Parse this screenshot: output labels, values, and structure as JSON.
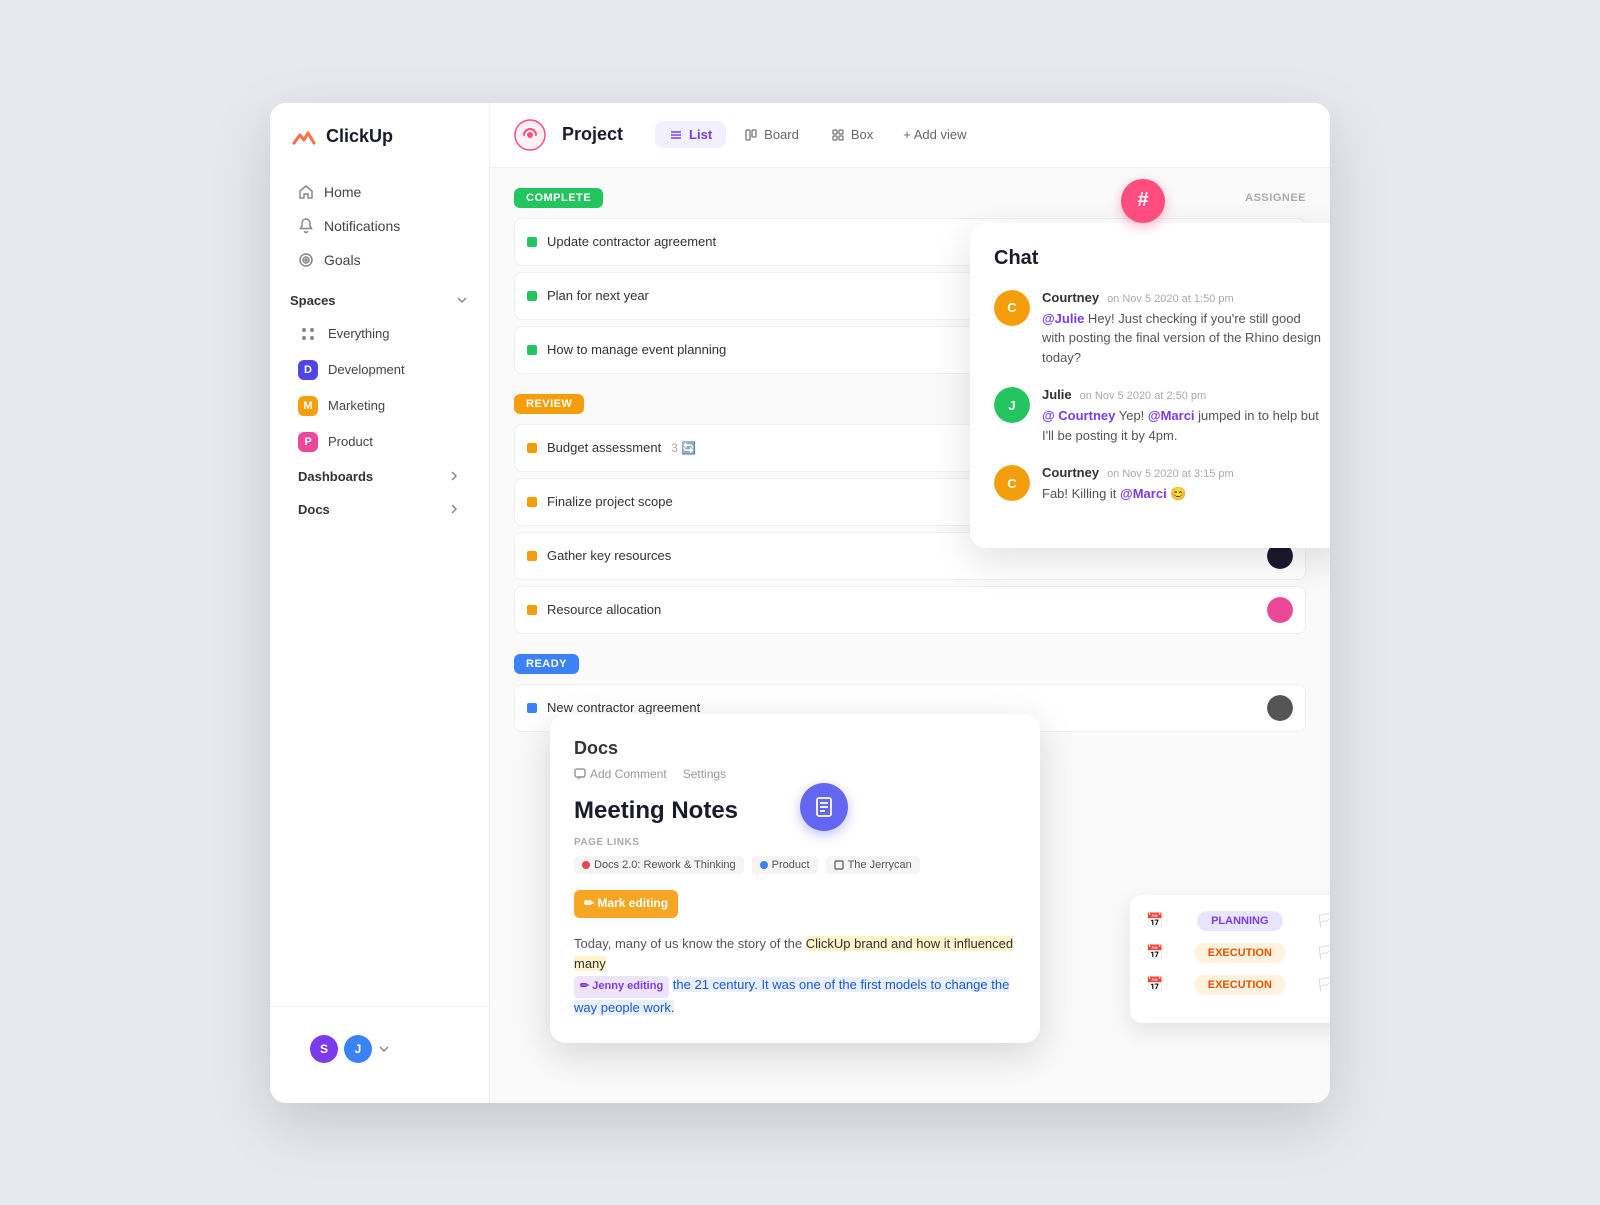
{
  "logo": {
    "text": "ClickUp"
  },
  "sidebar": {
    "nav_items": [
      {
        "id": "home",
        "label": "Home",
        "icon": "home-icon"
      },
      {
        "id": "notifications",
        "label": "Notifications",
        "icon": "bell-icon"
      },
      {
        "id": "goals",
        "label": "Goals",
        "icon": "goals-icon"
      }
    ],
    "spaces_label": "Spaces",
    "spaces": [
      {
        "id": "everything",
        "label": "Everything",
        "type": "everything"
      },
      {
        "id": "development",
        "label": "Development",
        "type": "badge",
        "color": "#4f46e5",
        "letter": "D"
      },
      {
        "id": "marketing",
        "label": "Marketing",
        "type": "badge",
        "color": "#f59e0b",
        "letter": "M"
      },
      {
        "id": "product",
        "label": "Product",
        "type": "badge",
        "color": "#ec4899",
        "letter": "P"
      }
    ],
    "expandable": [
      {
        "id": "dashboards",
        "label": "Dashboards"
      },
      {
        "id": "docs",
        "label": "Docs"
      }
    ],
    "users": [
      {
        "initials": "S",
        "color": "#7c3aed"
      },
      {
        "initials": "J",
        "color": "#3b82f6"
      }
    ]
  },
  "topbar": {
    "project_label": "Project",
    "tabs": [
      {
        "id": "list",
        "label": "List",
        "active": true
      },
      {
        "id": "board",
        "label": "Board",
        "active": false
      },
      {
        "id": "box",
        "label": "Box",
        "active": false
      }
    ],
    "add_view_label": "+ Add view"
  },
  "task_sections": [
    {
      "id": "complete",
      "label": "COMPLETE",
      "color": "#22c55e",
      "tasks": [
        {
          "id": "t1",
          "name": "Update contractor agreement",
          "avatar_color": "#ff6b9d"
        },
        {
          "id": "t2",
          "name": "Plan for next year",
          "avatar_color": "#f8d7b0"
        },
        {
          "id": "t3",
          "name": "How to manage event planning",
          "avatar_color": "#c4e0c0"
        }
      ]
    },
    {
      "id": "review",
      "label": "REVIEW",
      "color": "#f59e0b",
      "tasks": [
        {
          "id": "t4",
          "name": "Budget assessment",
          "subtasks": "3",
          "avatar_color": "#333"
        },
        {
          "id": "t5",
          "name": "Finalize project scope",
          "avatar_color": "#555"
        },
        {
          "id": "t6",
          "name": "Gather key resources",
          "avatar_color": "#1a1a2e"
        },
        {
          "id": "t7",
          "name": "Resource allocation",
          "avatar_color": "#ec4899"
        }
      ]
    },
    {
      "id": "ready",
      "label": "READY",
      "color": "#3b82f6",
      "tasks": [
        {
          "id": "t8",
          "name": "New contractor agreement",
          "avatar_color": "#555"
        }
      ]
    }
  ],
  "assignee_header": "ASSIGNEE",
  "chat": {
    "title": "Chat",
    "messages": [
      {
        "id": "m1",
        "author": "Courtney",
        "time": "on Nov 5 2020 at 1:50 pm",
        "text": "@Julie Hey! Just checking if you're still good with posting the final version of the Rhino design today?",
        "mention": "@Julie",
        "avatar_color": "#f59e0b"
      },
      {
        "id": "m2",
        "author": "Julie",
        "time": "on Nov 5 2020 at 2:50 pm",
        "text": "@ Courtney Yep! @Marci jumped in to help but I'll be posting it by 4pm.",
        "mention": "@Courtney",
        "avatar_color": "#22c55e"
      },
      {
        "id": "m3",
        "author": "Courtney",
        "time": "on Nov 5 2020 at 3:15 pm",
        "text": "Fab! Killing it @Marci 😊",
        "avatar_color": "#f59e0b"
      }
    ]
  },
  "hashtag_btn": "#",
  "docs": {
    "title": "Docs",
    "toolbar": {
      "add_comment": "Add Comment",
      "settings": "Settings"
    },
    "heading": "Meeting Notes",
    "page_links_label": "PAGE LINKS",
    "page_links": [
      {
        "label": "Docs 2.0: Rework & Thinking",
        "color": "#ef4444"
      },
      {
        "label": "Product",
        "color": "#3b82f6"
      },
      {
        "label": "The Jerrycan",
        "color": "#555"
      }
    ],
    "mark_editing_label": "✏ Mark editing",
    "body_text": "Today, many of us know the story of the ClickUp brand and how it influenced many",
    "jenny_editing": "✏ Jenny editing",
    "body_text2": "the 21 century. It was one of the first models  to change the way people work."
  },
  "sprint_panel": {
    "items": [
      {
        "tag": "PLANNING",
        "style": "planning"
      },
      {
        "tag": "EXECUTION",
        "style": "execution"
      },
      {
        "tag": "EXECUTION",
        "style": "execution"
      }
    ]
  }
}
